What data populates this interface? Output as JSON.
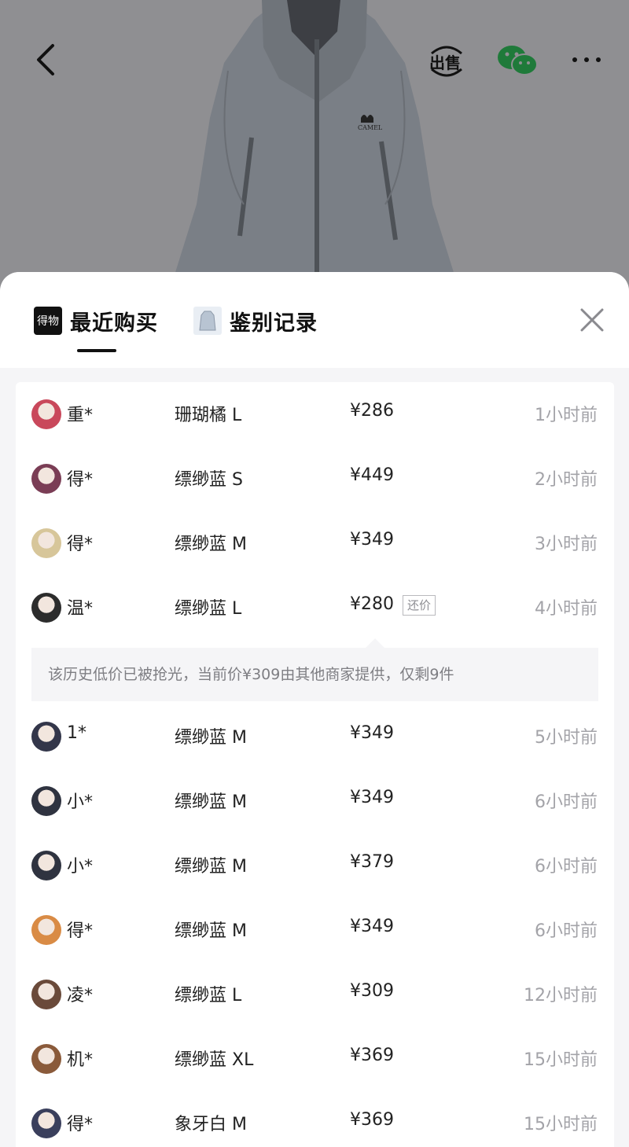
{
  "header": {
    "back_icon": "chevron-left-icon",
    "sell_label": "出售",
    "wechat_icon": "wechat-icon",
    "more_icon": "more-icon"
  },
  "hero": {
    "brand_logo": "CAMEL",
    "color": "#8f8f92"
  },
  "tabs": [
    {
      "label": "最近购买",
      "icon": "dewu-logo-icon",
      "logo_text": "得物",
      "active": true
    },
    {
      "label": "鉴别记录",
      "icon": "jacket-thumbnail-icon",
      "active": false
    }
  ],
  "close_icon": "close-icon",
  "purchases": [
    {
      "user": "重*",
      "spec": "珊瑚橘 L",
      "price": "¥286",
      "time": "1小时前",
      "avatar": "#c9485b"
    },
    {
      "user": "得*",
      "spec": "缥缈蓝 S",
      "price": "¥449",
      "time": "2小时前",
      "avatar": "#7a3d55"
    },
    {
      "user": "得*",
      "spec": "缥缈蓝 M",
      "price": "¥349",
      "time": "3小时前",
      "avatar": "#d7c69a"
    },
    {
      "user": "温*",
      "spec": "缥缈蓝 L",
      "price": "¥280",
      "tag": "还价",
      "time": "4小时前",
      "avatar": "#2c2c2c"
    },
    {
      "user": "1*",
      "spec": "缥缈蓝 M",
      "price": "¥349",
      "time": "5小时前",
      "avatar": "#33364a"
    },
    {
      "user": "小*",
      "spec": "缥缈蓝 M",
      "price": "¥349",
      "time": "6小时前",
      "avatar": "#2f3340"
    },
    {
      "user": "小*",
      "spec": "缥缈蓝 M",
      "price": "¥379",
      "time": "6小时前",
      "avatar": "#2f3340"
    },
    {
      "user": "得*",
      "spec": "缥缈蓝 M",
      "price": "¥349",
      "time": "6小时前",
      "avatar": "#d98b45"
    },
    {
      "user": "凌*",
      "spec": "缥缈蓝 L",
      "price": "¥309",
      "time": "12小时前",
      "avatar": "#6a4a3a"
    },
    {
      "user": "机*",
      "spec": "缥缈蓝 XL",
      "price": "¥369",
      "time": "15小时前",
      "avatar": "#8a5a3a"
    },
    {
      "user": "得*",
      "spec": "象牙白 M",
      "price": "¥369",
      "time": "15小时前",
      "avatar": "#3a3f5c"
    }
  ],
  "notice": "该历史低价已被抢光，当前价¥309由其他商家提供，仅剩9件"
}
